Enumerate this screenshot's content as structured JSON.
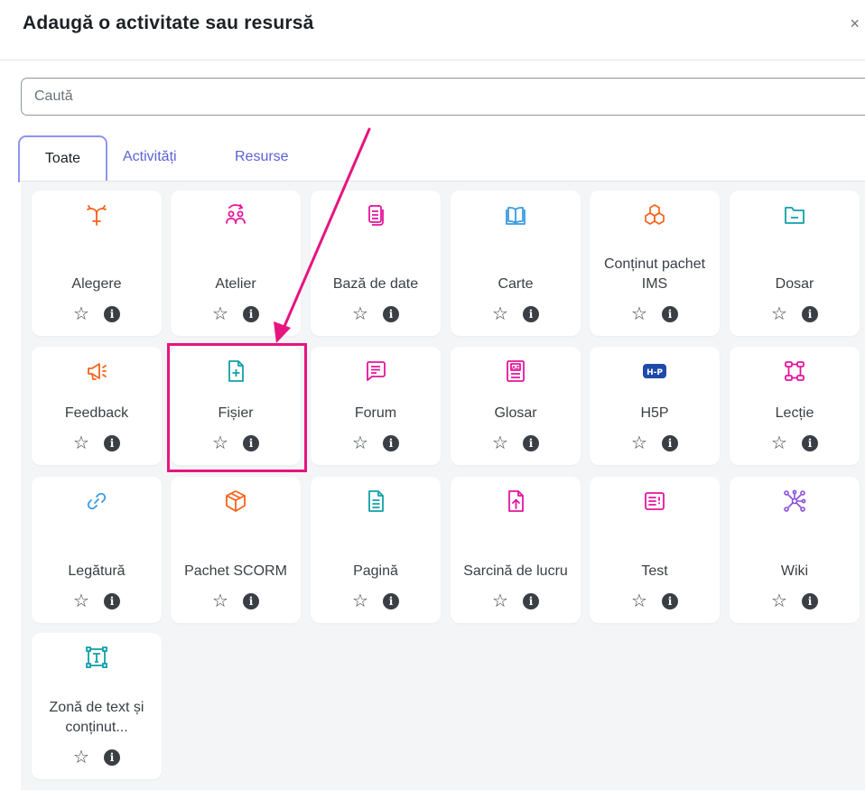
{
  "dialog": {
    "title": "Adaugă o activitate sau resursă",
    "close_symbol": "×"
  },
  "search": {
    "placeholder": "Caută",
    "value": ""
  },
  "tabs": [
    {
      "label": "Toate",
      "active": true
    },
    {
      "label": "Activități",
      "active": false
    },
    {
      "label": "Resurse",
      "active": false
    }
  ],
  "colors": {
    "orange": "#f7631a",
    "pink": "#e5149c",
    "blue": "#399be2",
    "teal": "#11a0a7",
    "annotation": "#e6157f"
  },
  "items": [
    {
      "name": "Alegere",
      "icon": "choice-arrows-icon"
    },
    {
      "name": "Atelier",
      "icon": "workshop-people-icon"
    },
    {
      "name": "Bază de date",
      "icon": "database-icon"
    },
    {
      "name": "Carte",
      "icon": "book-icon"
    },
    {
      "name": "Conținut pachet IMS",
      "icon": "ims-cubes-icon"
    },
    {
      "name": "Dosar",
      "icon": "folder-icon"
    },
    {
      "name": "Feedback",
      "icon": "megaphone-icon"
    },
    {
      "name": "Fișier",
      "icon": "file-plus-icon"
    },
    {
      "name": "Forum",
      "icon": "chat-bubble-icon"
    },
    {
      "name": "Glosar",
      "icon": "glossary-az-icon"
    },
    {
      "name": "H5P",
      "icon": "h5p-badge-icon",
      "badge": "H-P"
    },
    {
      "name": "Lecție",
      "icon": "lesson-nodes-icon"
    },
    {
      "name": "Legătură",
      "icon": "link-icon"
    },
    {
      "name": "Pachet SCORM",
      "icon": "scorm-box-icon"
    },
    {
      "name": "Pagină",
      "icon": "page-icon"
    },
    {
      "name": "Sarcină de lucru",
      "icon": "assignment-upload-icon"
    },
    {
      "name": "Test",
      "icon": "quiz-icon"
    },
    {
      "name": "Wiki",
      "icon": "wiki-network-icon"
    },
    {
      "name": "Zonă de text și conținut...",
      "icon": "text-area-icon"
    }
  ],
  "star_symbol": "☆",
  "info_symbol": "i"
}
